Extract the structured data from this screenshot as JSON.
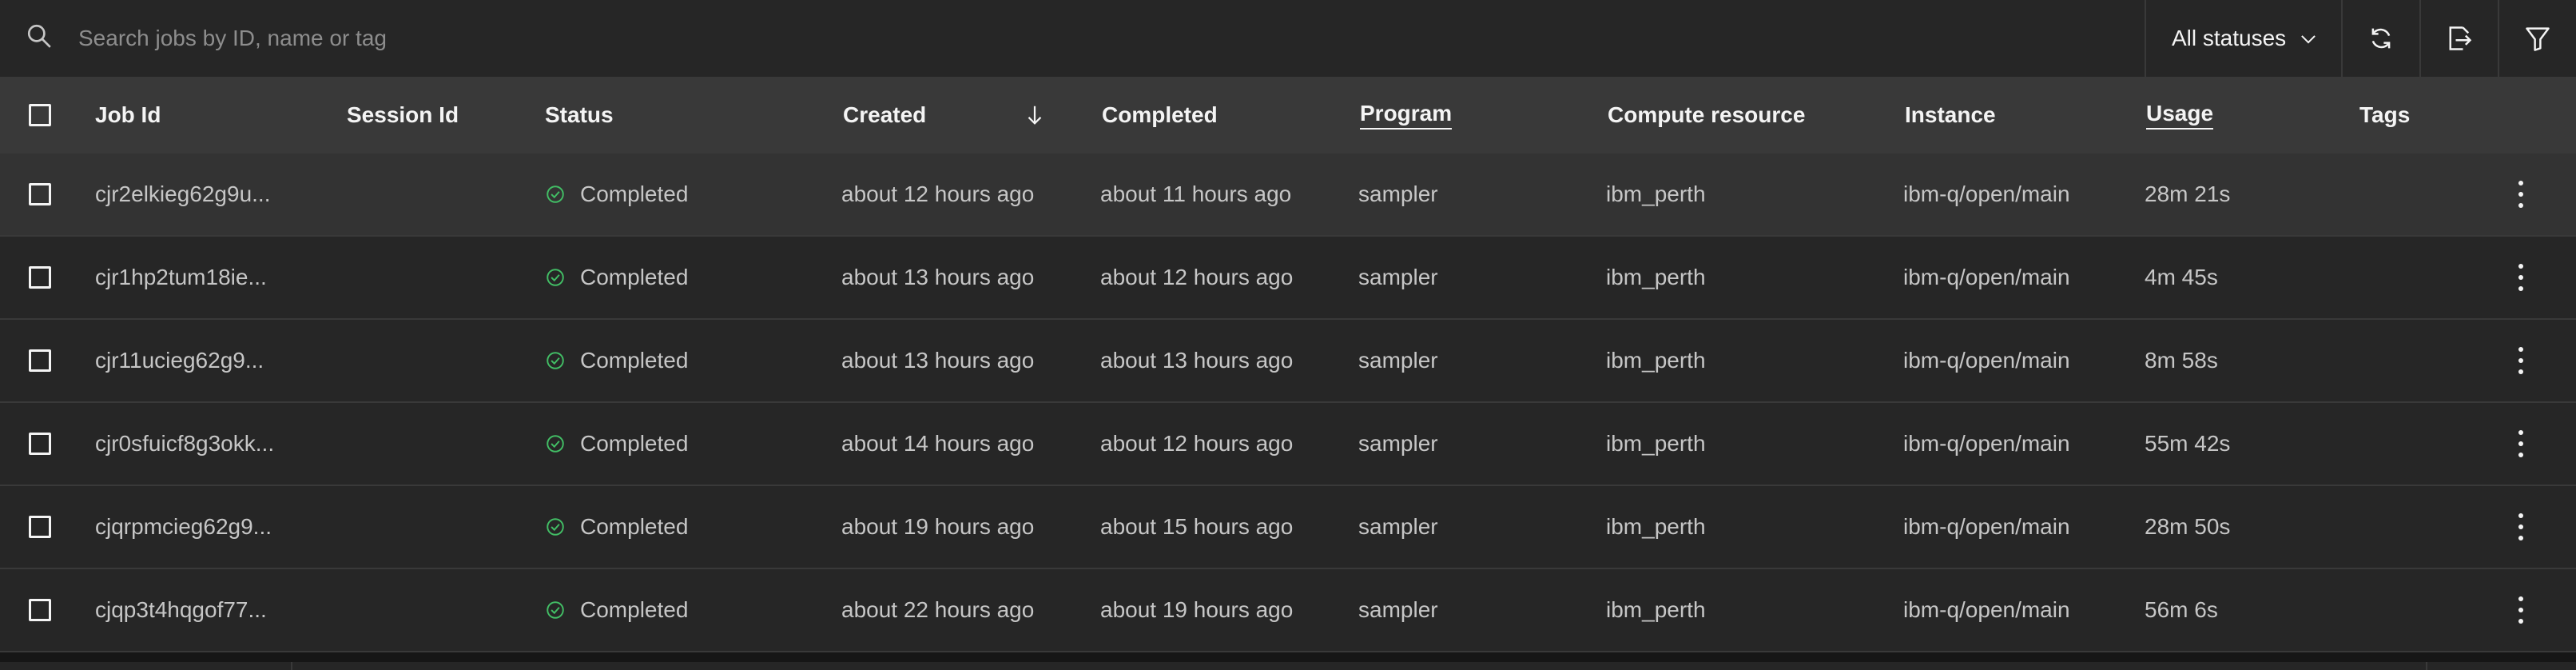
{
  "toolbar": {
    "search_placeholder": "Search jobs by ID, name or tag",
    "status_filter": "All statuses"
  },
  "table": {
    "columns": {
      "job_id": "Job Id",
      "session_id": "Session Id",
      "status": "Status",
      "created": "Created",
      "completed": "Completed",
      "program": "Program",
      "compute_resource": "Compute resource",
      "instance": "Instance",
      "usage": "Usage",
      "tags": "Tags"
    },
    "rows": [
      {
        "job_id": "cjr2elkieg62g9u...",
        "session_id": "",
        "status": "Completed",
        "created": "about 12 hours ago",
        "completed": "about 11 hours ago",
        "program": "sampler",
        "compute_resource": "ibm_perth",
        "instance": "ibm-q/open/main",
        "usage": "28m 21s",
        "tags": ""
      },
      {
        "job_id": "cjr1hp2tum18ie...",
        "session_id": "",
        "status": "Completed",
        "created": "about 13 hours ago",
        "completed": "about 12 hours ago",
        "program": "sampler",
        "compute_resource": "ibm_perth",
        "instance": "ibm-q/open/main",
        "usage": "4m 45s",
        "tags": ""
      },
      {
        "job_id": "cjr11ucieg62g9...",
        "session_id": "",
        "status": "Completed",
        "created": "about 13 hours ago",
        "completed": "about 13 hours ago",
        "program": "sampler",
        "compute_resource": "ibm_perth",
        "instance": "ibm-q/open/main",
        "usage": "8m 58s",
        "tags": ""
      },
      {
        "job_id": "cjr0sfuicf8g3okk...",
        "session_id": "",
        "status": "Completed",
        "created": "about 14 hours ago",
        "completed": "about 12 hours ago",
        "program": "sampler",
        "compute_resource": "ibm_perth",
        "instance": "ibm-q/open/main",
        "usage": "55m 42s",
        "tags": ""
      },
      {
        "job_id": "cjqrpmcieg62g9...",
        "session_id": "",
        "status": "Completed",
        "created": "about 19 hours ago",
        "completed": "about 15 hours ago",
        "program": "sampler",
        "compute_resource": "ibm_perth",
        "instance": "ibm-q/open/main",
        "usage": "28m 50s",
        "tags": ""
      },
      {
        "job_id": "cjqp3t4hqgof77...",
        "session_id": "",
        "status": "Completed",
        "created": "about 22 hours ago",
        "completed": "about 19 hours ago",
        "program": "sampler",
        "compute_resource": "ibm_perth",
        "instance": "ibm-q/open/main",
        "usage": "56m 6s",
        "tags": ""
      }
    ]
  },
  "colors": {
    "success": "#42be65",
    "background": "#161616",
    "row": "#262626",
    "header": "#393939"
  }
}
